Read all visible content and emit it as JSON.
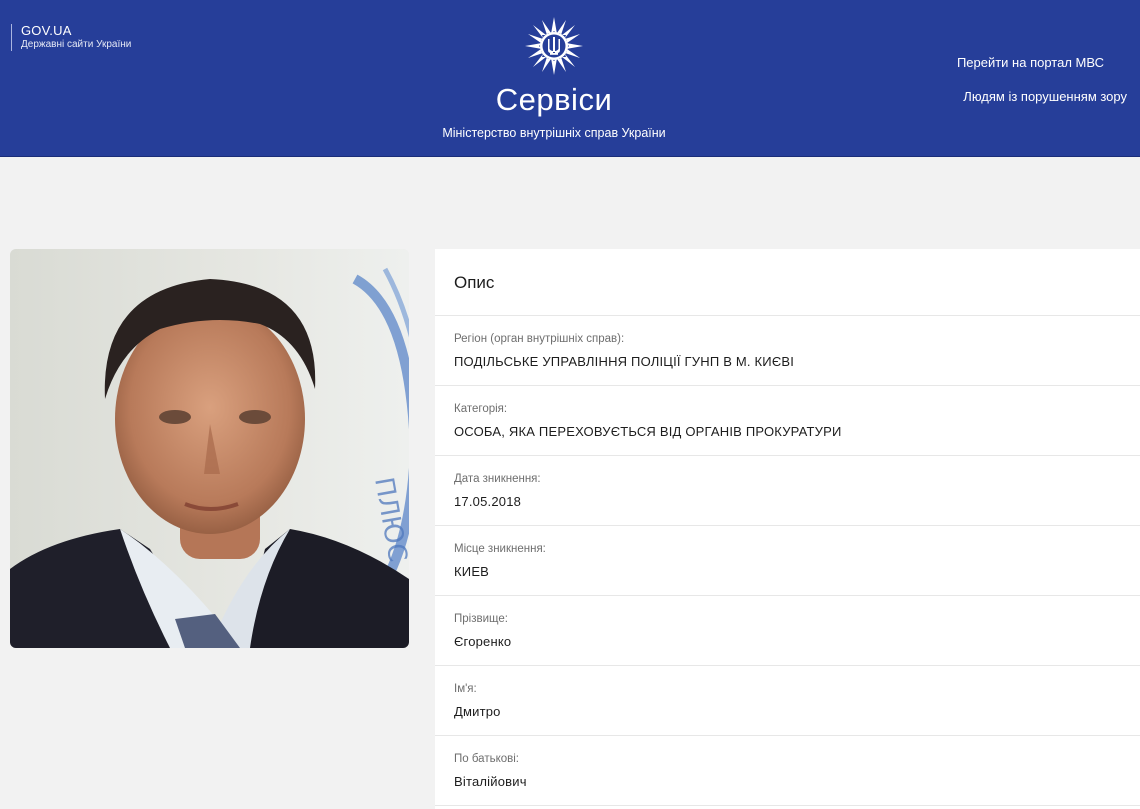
{
  "header": {
    "gov_title": "GOV.UA",
    "gov_subtitle": "Державні сайти України",
    "site_title": "Сервіси",
    "site_subtitle": "Міністерство внутрішніх справ України",
    "links": {
      "portal": "Перейти на портал МВС",
      "vision": "Людям із порушенням зору"
    },
    "emblem_icon": "police-star-trident-icon",
    "background_color": "#263e99"
  },
  "photo": {
    "stamp_text": "ПЛЮС"
  },
  "description": {
    "title": "Опис",
    "fields": [
      {
        "label": "Регіон (орган внутрішніх справ):",
        "value": "ПОДІЛЬСЬКЕ УПРАВЛІННЯ ПОЛІЦІЇ ГУНП В М. КИЄВІ"
      },
      {
        "label": "Категорія:",
        "value": "ОСОБА, ЯКА ПЕРЕХОВУЄТЬСЯ ВІД ОРГАНІВ ПРОКУРАТУРИ"
      },
      {
        "label": "Дата зникнення:",
        "value": "17.05.2018"
      },
      {
        "label": "Місце зникнення:",
        "value": "КИЕВ"
      },
      {
        "label": "Прізвище:",
        "value": "Єгоренко"
      },
      {
        "label": "Ім'я:",
        "value": "Дмитро"
      },
      {
        "label": "По батькові:",
        "value": "Віталійович"
      }
    ]
  }
}
